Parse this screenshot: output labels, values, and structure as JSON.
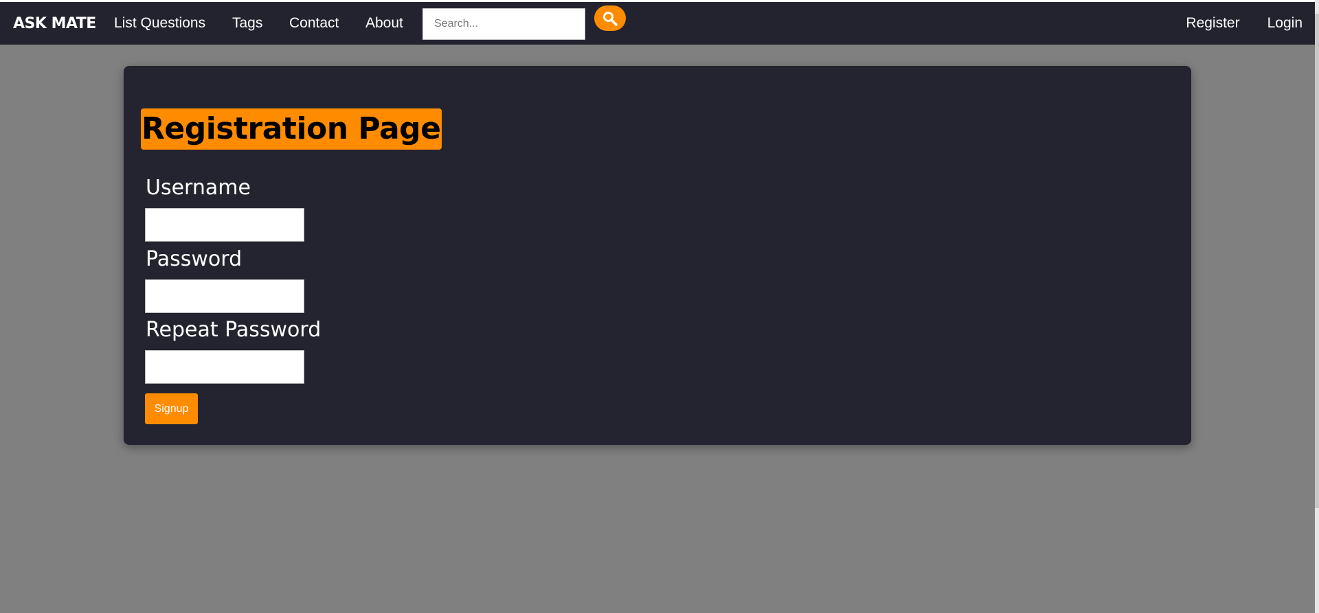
{
  "navbar": {
    "brand": "ASK MATE",
    "links": [
      "List Questions",
      "Tags",
      "Contact",
      "About"
    ],
    "search": {
      "placeholder": "Search...",
      "value": ""
    },
    "search_button_icon": "search-icon",
    "right_links": [
      "Register",
      "Login"
    ]
  },
  "main": {
    "title": "Registration Page",
    "fields": [
      {
        "label": "Username",
        "value": ""
      },
      {
        "label": "Password",
        "value": ""
      },
      {
        "label": "Repeat Password",
        "value": ""
      }
    ],
    "submit_label": "Signup"
  },
  "colors": {
    "accent": "#ff8c00",
    "navbar": "#232330",
    "card": "#242430",
    "background": "#808080"
  }
}
